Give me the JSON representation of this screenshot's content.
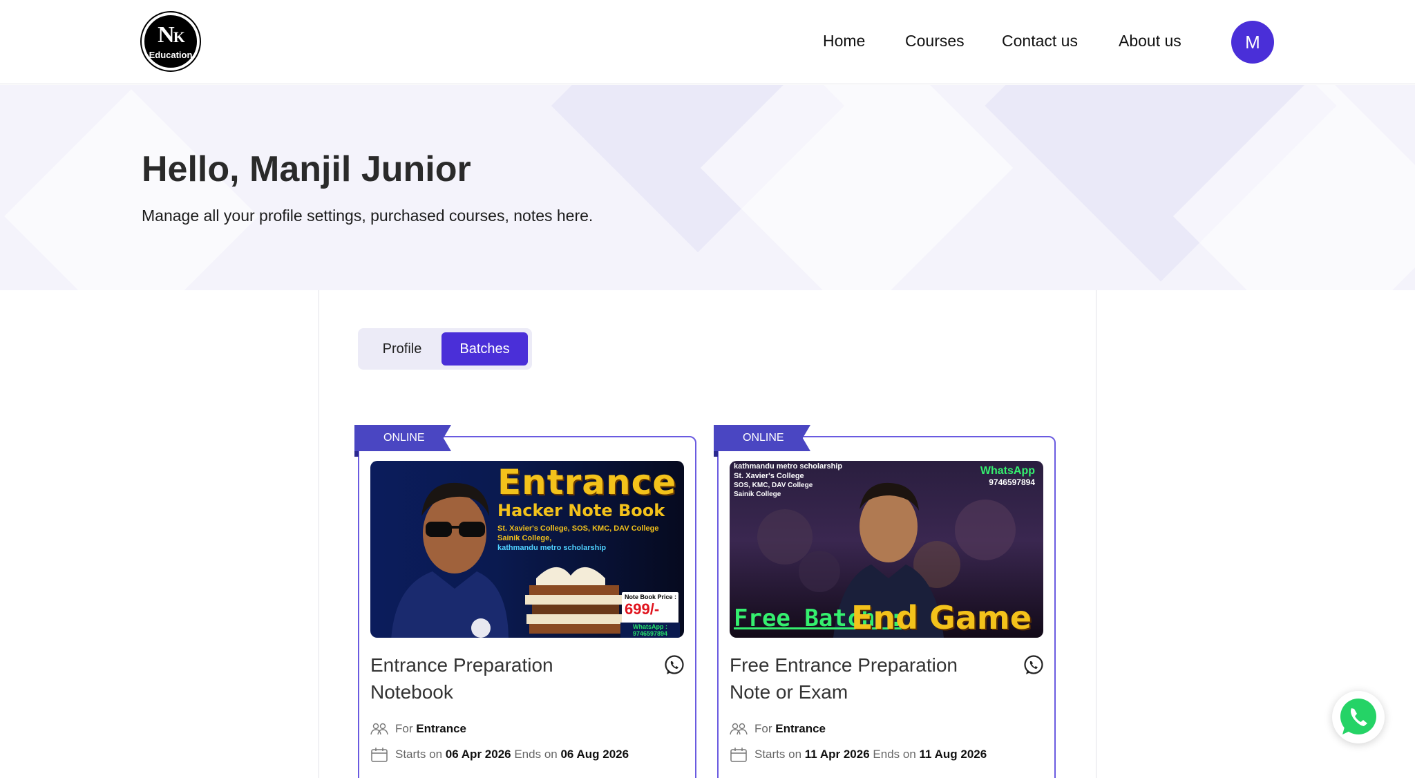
{
  "header": {
    "logo_big": "N",
    "logo_small": "K",
    "logo_sub": "Education",
    "nav": [
      "Home",
      "Courses",
      "Contact us",
      "About us"
    ],
    "avatar_initial": "M"
  },
  "hero": {
    "greeting": "Hello, Manjil Junior",
    "subtitle": "Manage all your profile settings, purchased courses, notes here."
  },
  "tabs": {
    "profile": "Profile",
    "batches": "Batches",
    "active": "Batches"
  },
  "cards": [
    {
      "badge": "ONLINE",
      "title": "Entrance Preparation Notebook",
      "for_label": "For",
      "for_value": "Entrance",
      "starts_label": "Starts on",
      "starts_value": "06 Apr 2026",
      "ends_label": "Ends on",
      "ends_value": "06 Aug 2026",
      "thumb": {
        "heading1": "Entrance",
        "heading2": "Hacker Note Book",
        "line1": "St. Xavier's College, SOS, KMC, DAV College",
        "line2": "Sainik College,",
        "line3": "kathmandu metro scholarship",
        "price_label": "Note Book Price :",
        "price": "699/-",
        "whatsapp": "WhatsApp : 9746597894"
      }
    },
    {
      "badge": "ONLINE",
      "title": "Free Entrance Preparation Note or Exam",
      "for_label": "For",
      "for_value": "Entrance",
      "starts_label": "Starts on",
      "starts_value": "11 Apr 2026",
      "ends_label": "Ends on",
      "ends_value": "11 Aug 2026",
      "thumb": {
        "line1": "kathmandu metro scholarship",
        "line2": "St. Xavier's College",
        "line3": "SOS, KMC, DAV College",
        "line4": "Sainik College",
        "whatsapp_label": "WhatsApp",
        "whatsapp_number": "9746597894",
        "free_batch": "Free Batch :",
        "end_game": "End Game"
      }
    }
  ],
  "colors": {
    "accent": "#4a2fd8",
    "ribbon": "#4a46c2",
    "card_border": "#6a5be0",
    "whatsapp": "#25d366"
  }
}
